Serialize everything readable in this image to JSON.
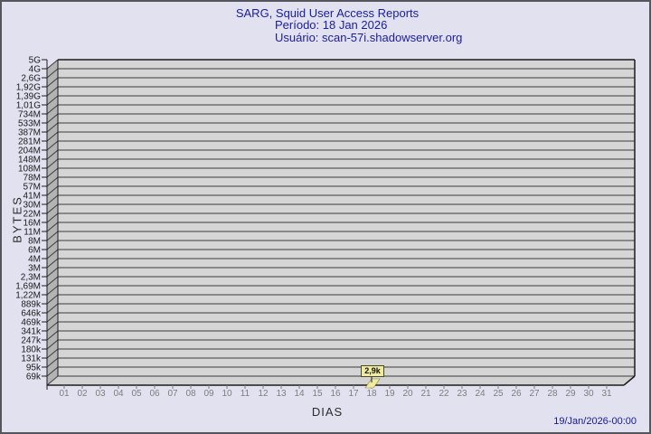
{
  "header": {
    "title": "SARG, Squid User Access Reports",
    "period": "Período: 18 Jan 2026",
    "user": "Usuário: scan-57i.shadowserver.org"
  },
  "footer": {
    "timestamp": "19/Jan/2026-00:00"
  },
  "chart_data": {
    "type": "bar",
    "style": "3d",
    "title": "SARG, Squid User Access Reports",
    "subtitle": [
      "Período: 18 Jan 2026",
      "Usuário: scan-57i.shadowserver.org"
    ],
    "xlabel": "DIAS",
    "ylabel": "BYTES",
    "legend": null,
    "grid": true,
    "y_scale": "logarithmic",
    "y_axis_range": [
      "69k",
      "5G"
    ],
    "y_tick_labels": [
      "5G",
      "4G",
      "2,6G",
      "1,92G",
      "1,39G",
      "1,01G",
      "734M",
      "533M",
      "387M",
      "281M",
      "204M",
      "148M",
      "108M",
      "78M",
      "57M",
      "41M",
      "30M",
      "22M",
      "16M",
      "11M",
      "8M",
      "6M",
      "4M",
      "3M",
      "2,3M",
      "1,69M",
      "1,22M",
      "889k",
      "646k",
      "469k",
      "341k",
      "247k",
      "180k",
      "131k",
      "95k",
      "69k"
    ],
    "categories": [
      "01",
      "02",
      "03",
      "04",
      "05",
      "06",
      "07",
      "08",
      "09",
      "10",
      "11",
      "12",
      "13",
      "14",
      "15",
      "16",
      "17",
      "18",
      "19",
      "20",
      "21",
      "22",
      "23",
      "24",
      "25",
      "26",
      "27",
      "28",
      "29",
      "30",
      "31"
    ],
    "values": [
      0,
      0,
      0,
      0,
      0,
      0,
      0,
      0,
      0,
      0,
      0,
      0,
      0,
      0,
      0,
      0,
      0,
      2900,
      0,
      0,
      0,
      0,
      0,
      0,
      0,
      0,
      0,
      0,
      0,
      0,
      0
    ],
    "point_label": "2,9k",
    "point_label_day": "18"
  },
  "colors": {
    "background": "#e1e1f0",
    "title_text": "#1c1c9e",
    "plot_bg": "#d5d5d5",
    "wall_fill": "#b3b3b3",
    "floor_fill": "#d2d2d2",
    "grid_line": "#3c3c3c",
    "border_line": "#1c1c1c",
    "bar_fill": "#f1eb9e",
    "bar_edge": "#8a8340",
    "x_label_text": "#7d7d7d",
    "y_label_text": "#1a1a1a"
  }
}
